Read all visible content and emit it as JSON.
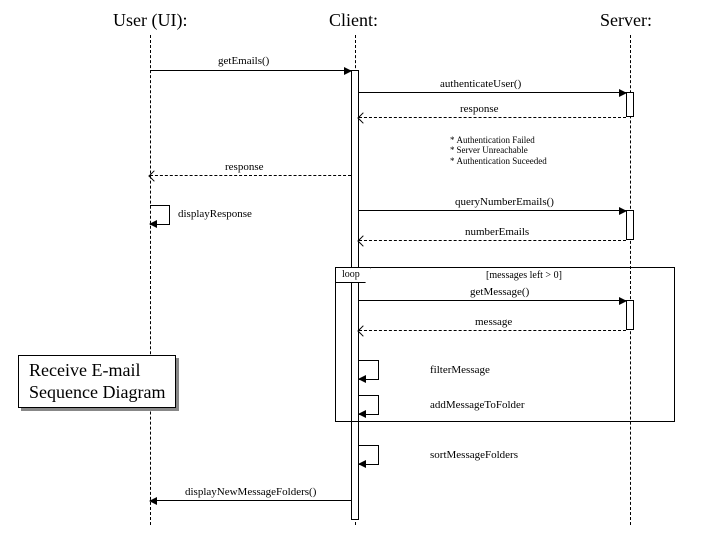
{
  "participants": {
    "user": "User (UI):",
    "client": "Client:",
    "server": "Server:"
  },
  "messages": {
    "getEmails": "getEmails()",
    "authenticateUser": "authenticateUser()",
    "responseAuth": "response",
    "responseUser": "response",
    "displayResponse": "displayResponse",
    "queryNumberEmails": "queryNumberEmails()",
    "numberEmails": "numberEmails",
    "getMessage": "getMessage()",
    "message": "message",
    "filterMessage": "filterMessage",
    "addMessageToFolder": "addMessageToFolder",
    "sortMessageFolders": "sortMessageFolders",
    "displayNewMessageFolders": "displayNewMessageFolders()"
  },
  "note": {
    "items": [
      "Authentication Failed",
      "Server Unreachable",
      "Authentication Suceeded"
    ]
  },
  "loop": {
    "label": "loop",
    "guard": "[messages left > 0]"
  },
  "title": {
    "line1": "Receive E-mail",
    "line2": "Sequence Diagram"
  }
}
